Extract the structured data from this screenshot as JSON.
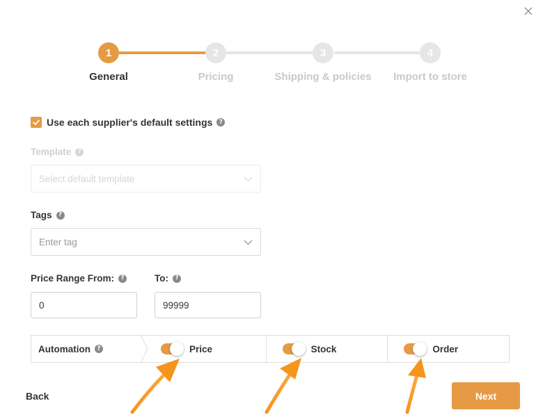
{
  "close": {
    "icon": "close-icon"
  },
  "stepper": {
    "steps": [
      {
        "number": "1",
        "label": "General",
        "active": true
      },
      {
        "number": "2",
        "label": "Pricing",
        "active": false
      },
      {
        "number": "3",
        "label": "Shipping & policies",
        "active": false
      },
      {
        "number": "4",
        "label": "Import to store",
        "active": false
      }
    ]
  },
  "form": {
    "default_settings": {
      "label": "Use each supplier's default settings",
      "checked": true,
      "help_icon": "help-icon"
    },
    "template": {
      "label": "Template",
      "placeholder": "Select default template",
      "disabled": true
    },
    "tags": {
      "label": "Tags",
      "placeholder": "Enter tag"
    },
    "price_range": {
      "from_label": "Price Range From:",
      "from_value": "0",
      "to_label": "To:",
      "to_value": "99999"
    },
    "automation": {
      "label": "Automation",
      "toggles": [
        {
          "label": "Price",
          "on": true
        },
        {
          "label": "Stock",
          "on": true
        },
        {
          "label": "Order",
          "on": true
        }
      ]
    }
  },
  "footer": {
    "back_label": "Back",
    "next_label": "Next"
  },
  "colors": {
    "accent": "#e69a43",
    "annotation_arrow": "#f7941d"
  }
}
